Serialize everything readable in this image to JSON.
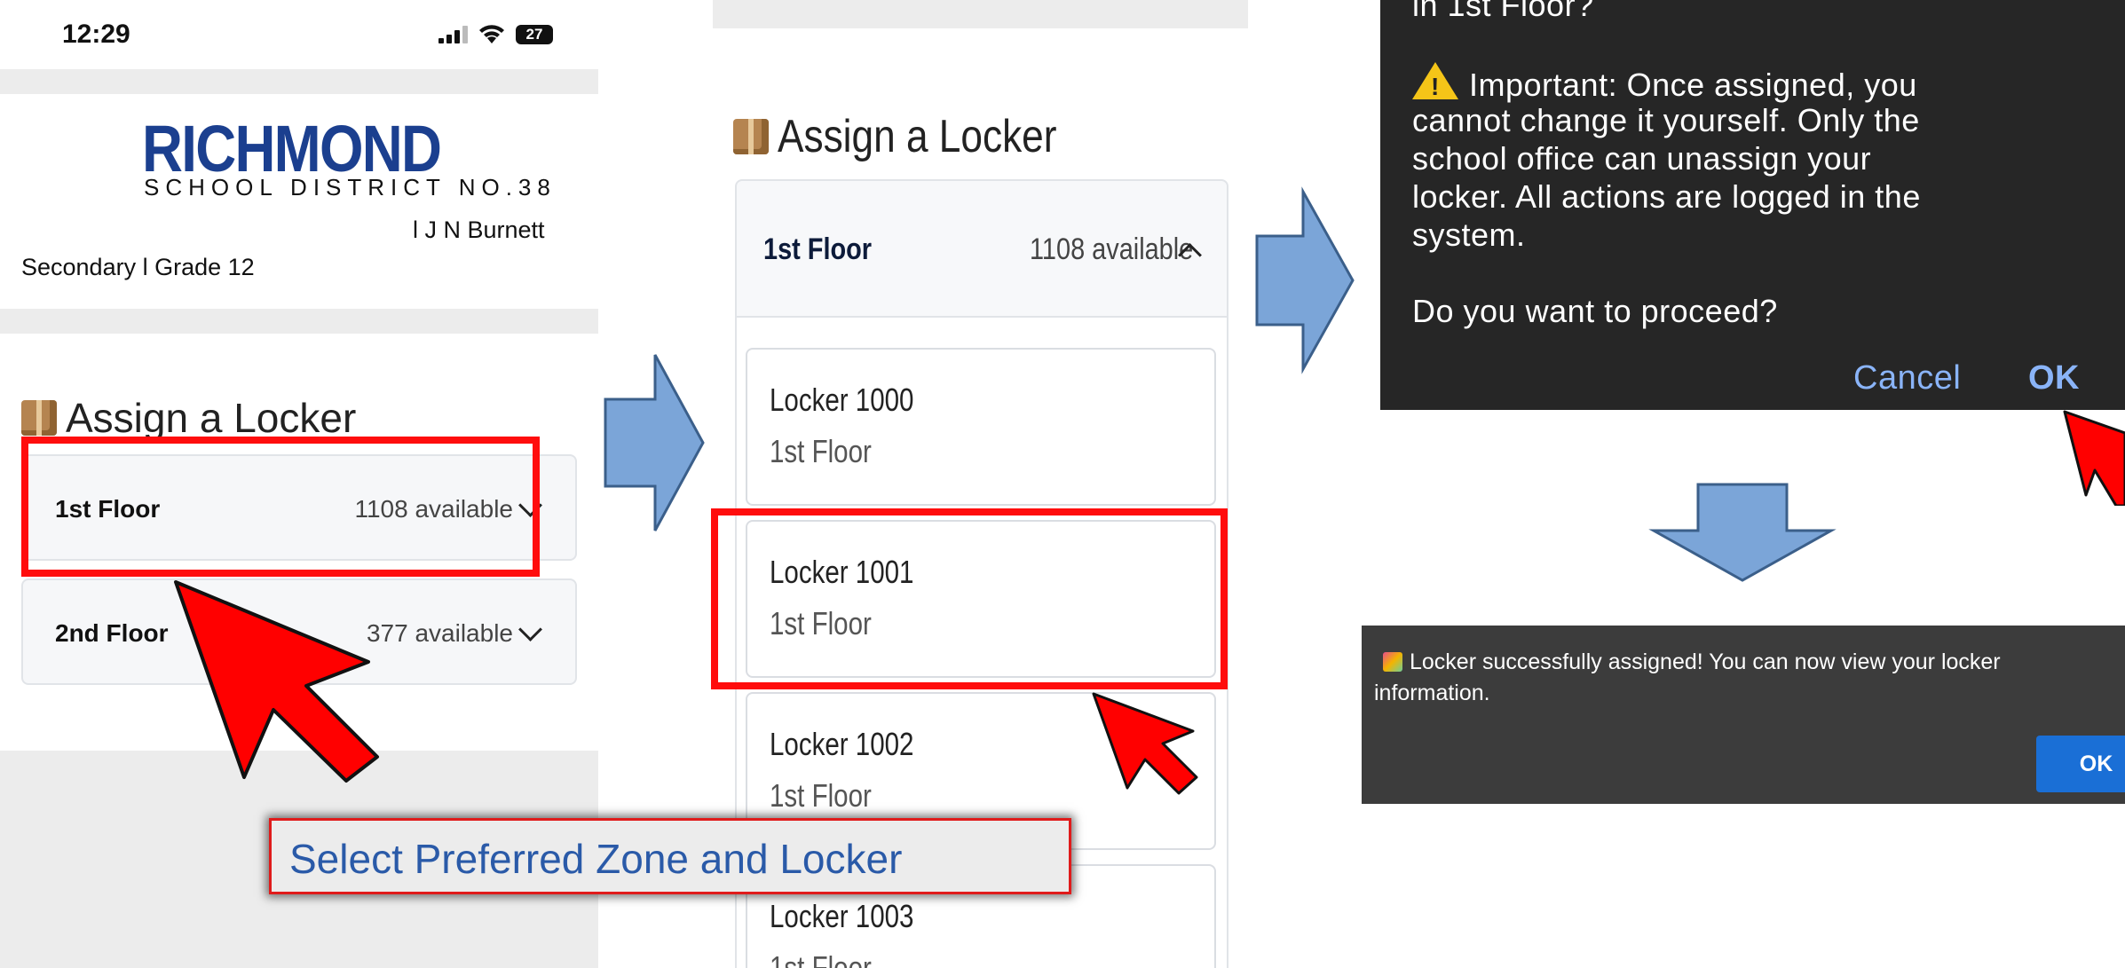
{
  "phone": {
    "status": {
      "time": "12:29",
      "battery": "27"
    },
    "logo": {
      "main": "RICHMOND",
      "sub": "SCHOOL DISTRICT NO.38"
    },
    "user": {
      "name": "l J N Burnett",
      "grade": "Secondary l Grade 12"
    },
    "section_title": "Assign a Locker",
    "floors": [
      {
        "name": "1st Floor",
        "available": "1108 available"
      },
      {
        "name": "2nd Floor",
        "available": "377 available"
      }
    ]
  },
  "locker_list": {
    "section_title": "Assign a Locker",
    "zone": {
      "name": "1st Floor",
      "available": "1108 available"
    },
    "lockers": [
      {
        "name": "Locker 1000",
        "floor": "1st Floor"
      },
      {
        "name": "Locker 1001",
        "floor": "1st Floor"
      },
      {
        "name": "Locker 1002",
        "floor": "1st Floor"
      },
      {
        "name": "Locker 1003",
        "floor": "1st Floor"
      }
    ]
  },
  "caption": "Select Preferred Zone and Locker",
  "confirm_dialog": {
    "line_partial": "in 1st Floor?",
    "warning_lines": [
      "Important: Once assigned, you",
      "cannot change it yourself. Only the",
      "school office can unassign your",
      "locker. All actions are logged in the",
      "system."
    ],
    "question": "Do you want to proceed?",
    "cancel_label": "Cancel",
    "ok_label": "OK"
  },
  "success_toast": {
    "line1": "Locker successfully assigned! You can now view your locker",
    "line2": "information.",
    "ok_label": "OK"
  },
  "colors": {
    "highlight_red": "#ff0d0d",
    "flow_arrow": "#7ba5d8",
    "logo_blue": "#1b3f8f",
    "dialog_link": "#8ab4f8",
    "ok_button": "#1a6fd6"
  }
}
